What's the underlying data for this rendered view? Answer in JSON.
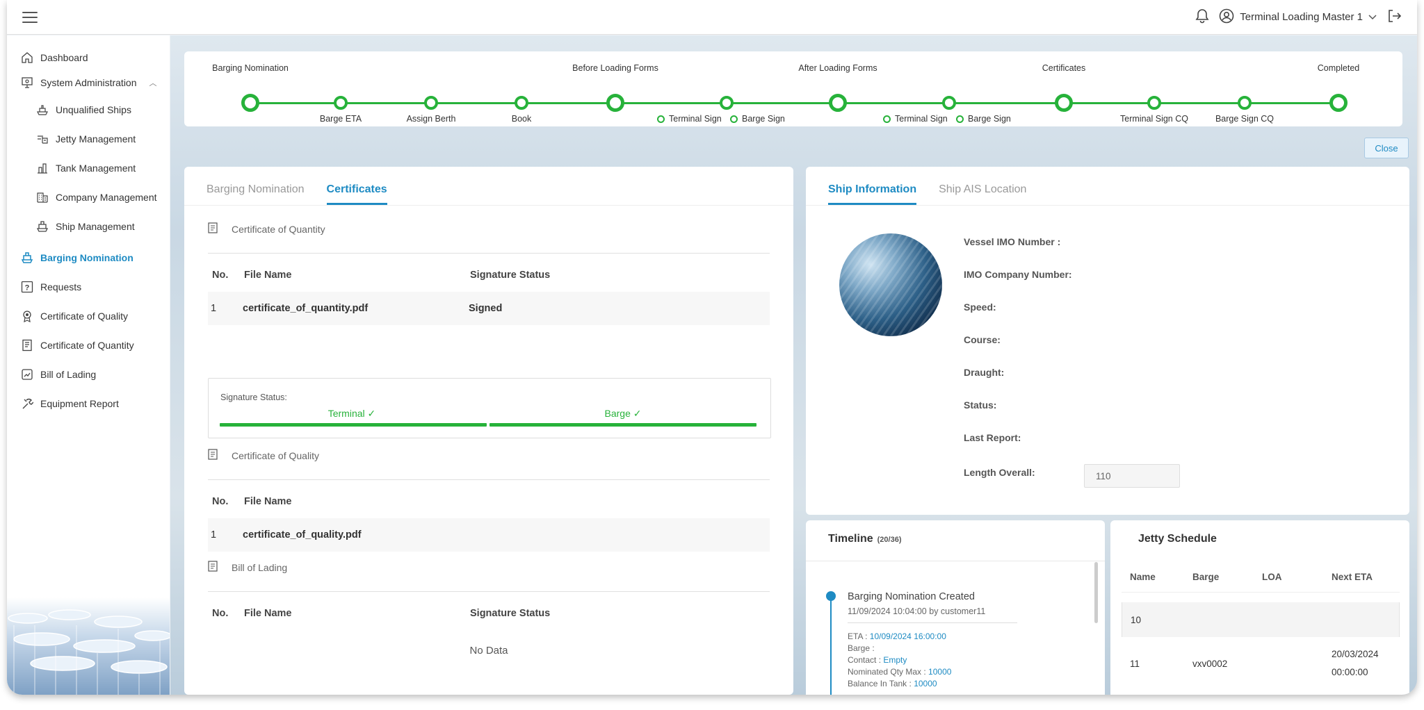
{
  "header": {
    "user_name": "Terminal Loading Master 1"
  },
  "sidebar": {
    "items": [
      {
        "label": "Dashboard"
      },
      {
        "label": "System Administration"
      },
      {
        "label": "Unqualified Ships"
      },
      {
        "label": "Jetty Management"
      },
      {
        "label": "Tank Management"
      },
      {
        "label": "Company Management"
      },
      {
        "label": "Ship Management"
      },
      {
        "label": "Barging Nomination"
      },
      {
        "label": "Requests"
      },
      {
        "label": "Certificate of Quality"
      },
      {
        "label": "Certificate of Quantity"
      },
      {
        "label": "Bill of Lading"
      },
      {
        "label": "Equipment Report"
      }
    ]
  },
  "stepper": {
    "top_labels": [
      "Barging Nomination",
      "Before Loading Forms",
      "After Loading Forms",
      "Certificates",
      "Completed"
    ],
    "bottom_labels": [
      "Barge ETA",
      "Assign Berth",
      "Book",
      "Terminal Sign CQ",
      "Barge Sign CQ"
    ],
    "sub_steps": [
      "Terminal Sign",
      "Barge Sign",
      "Terminal Sign",
      "Barge Sign"
    ],
    "accent_color": "#27b23a"
  },
  "close_label": "Close",
  "left_panel": {
    "tabs": [
      "Barging Nomination",
      "Certificates"
    ],
    "coq": {
      "title": "Certificate of Quantity",
      "headers": [
        "No.",
        "File Name",
        "Signature Status"
      ],
      "rows": [
        {
          "no": "1",
          "file": "certificate_of_quantity.pdf",
          "status": "Signed"
        }
      ]
    },
    "signature": {
      "label": "Signature Status:",
      "terminal": "Terminal ✓",
      "barge": "Barge ✓"
    },
    "cql": {
      "title": "Certificate of Quality",
      "headers": [
        "No.",
        "File Name"
      ],
      "rows": [
        {
          "no": "1",
          "file": "certificate_of_quality.pdf"
        }
      ]
    },
    "bol": {
      "title": "Bill of Lading",
      "headers": [
        "No.",
        "File Name",
        "Signature Status"
      ],
      "empty": "No Data"
    }
  },
  "right_panel": {
    "tabs": [
      "Ship Information",
      "Ship AIS Location"
    ],
    "fields": [
      "Vessel IMO Number :",
      "IMO Company Number:",
      "Speed:",
      "Course:",
      "Draught:",
      "Status:",
      "Last Report:",
      "Length Overall:"
    ],
    "length_overall_value": "110"
  },
  "timeline": {
    "title": "Timeline",
    "count": "(20/36)",
    "event_title": "Barging Nomination Created",
    "event_sub": "11/09/2024 10:04:00 by customer11",
    "details": [
      {
        "label": "ETA : ",
        "value": "10/09/2024 16:00:00"
      },
      {
        "label": "Barge : ",
        "value": ""
      },
      {
        "label": "Contact : ",
        "value": "Empty"
      },
      {
        "label": "Nominated Qty Max : ",
        "value": "10000"
      },
      {
        "label": "Balance In Tank : ",
        "value": "10000"
      }
    ]
  },
  "jetty": {
    "title": "Jetty Schedule",
    "headers": [
      "Name",
      "Barge",
      "LOA",
      "Next ETA"
    ],
    "rows": [
      {
        "name": "10",
        "barge": "",
        "loa": "",
        "eta": ""
      },
      {
        "name": "11",
        "barge": "vxv0002",
        "loa": "",
        "eta": "20/03/2024 00:00:00"
      }
    ]
  }
}
